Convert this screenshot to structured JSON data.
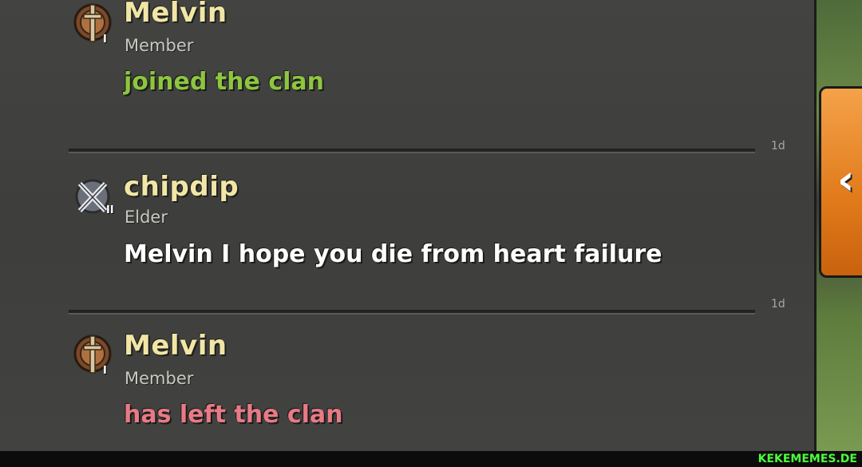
{
  "chat": {
    "messages": [
      {
        "name": "Melvin",
        "role": "Member",
        "badge_level": "I",
        "text": "joined the clan",
        "text_color": "#8dc63f",
        "type": "event"
      },
      {
        "time": "1d",
        "name": "chipdip",
        "role": "Elder",
        "badge_level": "II",
        "text": "Melvin I hope you die from heart failure",
        "text_color": "#ffffff",
        "type": "chat"
      },
      {
        "time": "1d",
        "name": "Melvin",
        "role": "Member",
        "badge_level": "I",
        "text": "has left the clan",
        "text_color": "#e87a86",
        "type": "event"
      }
    ]
  },
  "sidebar": {
    "collapse_icon": "chevron-left-icon",
    "collapse_label": "‹",
    "accent": "#e07a1a"
  },
  "watermark": "KEKEMEMES.DE"
}
